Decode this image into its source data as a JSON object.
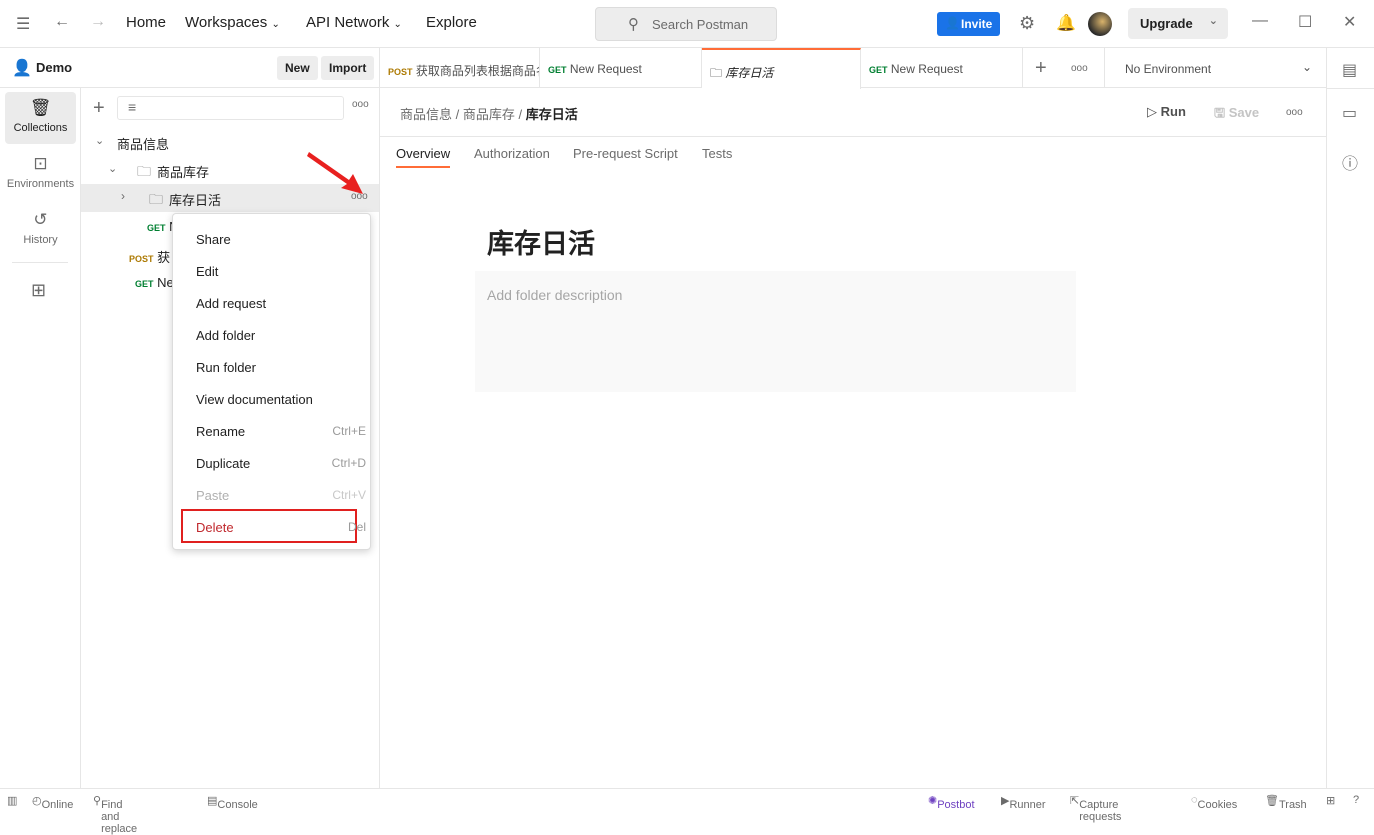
{
  "topbar": {
    "home": "Home",
    "workspaces": "Workspaces",
    "api_network": "API Network",
    "explore": "Explore",
    "search_placeholder": "Search Postman",
    "invite": "Invite",
    "upgrade": "Upgrade"
  },
  "workspace": {
    "name": "Demo",
    "new": "New",
    "import": "Import"
  },
  "rail": [
    {
      "label": "Collections",
      "icon": "collections-icon"
    },
    {
      "label": "Environments",
      "icon": "environments-icon"
    },
    {
      "label": "History",
      "icon": "history-icon"
    }
  ],
  "tree": {
    "collection": "商品信息",
    "folder": "商品库存",
    "subfolder": "库存日活",
    "requests": [
      {
        "method": "GET",
        "name": "N"
      },
      {
        "method": "POST",
        "name": "获"
      },
      {
        "method": "GET",
        "name": "Ne"
      }
    ]
  },
  "context_menu": [
    {
      "label": "Share",
      "shortcut": ""
    },
    {
      "label": "Edit",
      "shortcut": ""
    },
    {
      "label": "Add request",
      "shortcut": ""
    },
    {
      "label": "Add folder",
      "shortcut": ""
    },
    {
      "label": "Run folder",
      "shortcut": ""
    },
    {
      "label": "View documentation",
      "shortcut": ""
    },
    {
      "label": "Rename",
      "shortcut": "Ctrl+E"
    },
    {
      "label": "Duplicate",
      "shortcut": "Ctrl+D"
    },
    {
      "label": "Paste",
      "shortcut": "Ctrl+V",
      "disabled": true
    },
    {
      "label": "Delete",
      "shortcut": "Del",
      "highlighted": true
    }
  ],
  "tabs": [
    {
      "method": "POST",
      "name": "获取商品列表根据商品名"
    },
    {
      "method": "GET",
      "name": "New Request"
    },
    {
      "method": "",
      "name": "库存日活",
      "active": true
    },
    {
      "method": "GET",
      "name": "New Request"
    }
  ],
  "environment": "No Environment",
  "breadcrumb": [
    "商品信息",
    "商品库存",
    "库存日活"
  ],
  "actions": {
    "run": "Run",
    "save": "Save"
  },
  "subtabs": [
    "Overview",
    "Authorization",
    "Pre-request Script",
    "Tests"
  ],
  "folder": {
    "title": "库存日活",
    "description_placeholder": "Add folder description"
  },
  "status": {
    "online": "Online",
    "find": "Find and replace",
    "console": "Console",
    "postbot": "Postbot",
    "runner": "Runner",
    "capture": "Capture requests",
    "cookies": "Cookies",
    "trash": "Trash"
  },
  "colors": {
    "accent": "#ff6c37",
    "invite": "#1a73e8",
    "delete": "#d32f2f",
    "postbot": "#6f42c1"
  }
}
